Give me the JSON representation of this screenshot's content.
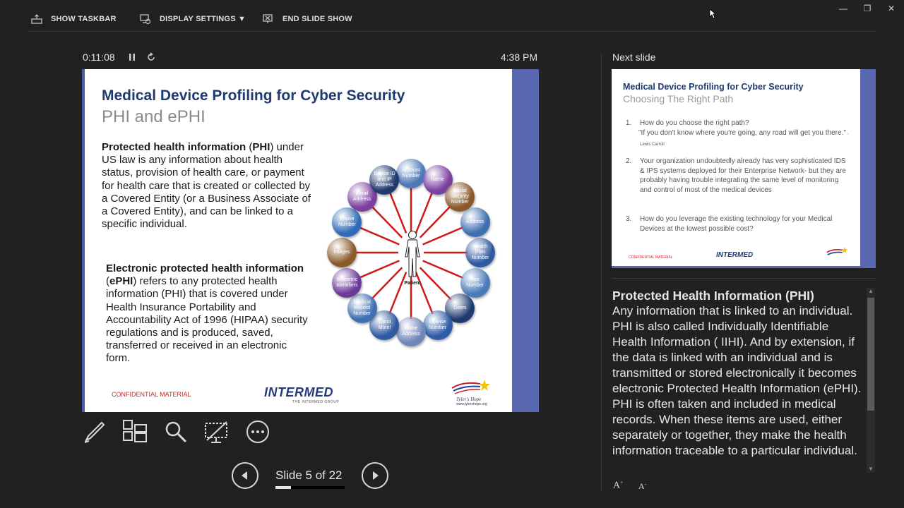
{
  "topbar": {
    "show_taskbar": "SHOW TASKBAR",
    "display_settings": "DISPLAY SETTINGS ▼",
    "end_show": "END SLIDE SHOW"
  },
  "presenter": {
    "timer": "0:11:08",
    "clock": "4:38 PM",
    "slide_counter": "Slide 5 of 22",
    "progress": 0.227
  },
  "slide": {
    "title": "Medical Device Profiling for Cyber Security",
    "subtitle": "PHI and ePHI",
    "para1_bold": "Protected health information",
    "para1_open": " (",
    "para1_bold2": "PHI",
    "para1_rest": ") under US law is any information about health status, provision of health care, or payment for health care that is created or collected by a Covered Entity (or a Business Associate of a Covered Entity), and can be linked to a specific individual.",
    "para2_bold": "Electronic protected health information",
    "para2_open": " (",
    "para2_bold2": "ePHI",
    "para2_rest": ") refers to any protected health information (PHI) that is covered under Health Insurance Portability and Accountability Act of 1996 (HIPAA) security regulations and is produced, saved, transferred or received in an electronic form.",
    "footer_conf": "CONFIDENTIAL MATERIAL",
    "logo_intermed": "INTERMED",
    "logo_intermed_sub": "THE INTERMED GROUP",
    "logo_tyler_sub": "www.tylershope.org",
    "diagram": {
      "center": "Patient",
      "nodes": [
        {
          "label": "Account Number",
          "color": "#4f78b8"
        },
        {
          "label": "Name",
          "color": "#7b3fa0"
        },
        {
          "label": "Social Security Number",
          "color": "#8a5a2b"
        },
        {
          "label": "Address",
          "color": "#3f6fb0"
        },
        {
          "label": "Health Plan Number",
          "color": "#2f5aa0"
        },
        {
          "label": "Fax Number",
          "color": "#4a7ab8"
        },
        {
          "label": "Dates",
          "color": "#1f3a6e"
        },
        {
          "label": "License Number",
          "color": "#2e5ca8"
        },
        {
          "label": "Home Address",
          "color": "#6f86b8"
        },
        {
          "label": "...and More!",
          "color": "#2f5aa0"
        },
        {
          "label": "Medical Record Number",
          "color": "#3f6fb0"
        },
        {
          "label": "Biometric Identifiers",
          "color": "#6a3a98"
        },
        {
          "label": "Images",
          "color": "#8a5a2b"
        },
        {
          "label": "Phone Number",
          "color": "#2f6ab8"
        },
        {
          "label": "Email Address",
          "color": "#7b3fa0"
        },
        {
          "label": "Device ID and IP Address",
          "color": "#1f3a6e"
        }
      ]
    }
  },
  "next": {
    "label": "Next slide",
    "title": "Medical Device Profiling for Cyber Security",
    "subtitle": "Choosing The Right Path",
    "items": [
      {
        "num": "1.",
        "text": "How do you choose the right path?",
        "quote": "\"If you don't know where you're going, any road will get you there.\"",
        "cite": " -Lewis Carroll"
      },
      {
        "num": "2.",
        "text": "Your organization undoubtedly already has very sophisticated IDS & IPS systems deployed for their Enterprise Network- but they are probably having trouble integrating the same level of monitoring and control of most of the medical devices"
      },
      {
        "num": "3.",
        "text": "How do you leverage the existing technology for your Medical Devices at the lowest possible cost?"
      }
    ],
    "conf": "CONFIDENTIAL MATERIAL",
    "logo": "INTERMED"
  },
  "notes": {
    "title": "Protected Health Information (PHI)",
    "body": "Any information that is linked to an individual.  PHI is also called Individually Identifiable Health Information ( IIHI).  And by extension, if the data is linked with an individual and is transmitted or stored electronically it becomes electronic Protected Health Information (ePHI). PHI is often taken and included in medical records. When these items are used, either separately or together, they make the health information traceable to a particular individual."
  },
  "font_buttons": {
    "increase": "A",
    "decrease": "A"
  }
}
